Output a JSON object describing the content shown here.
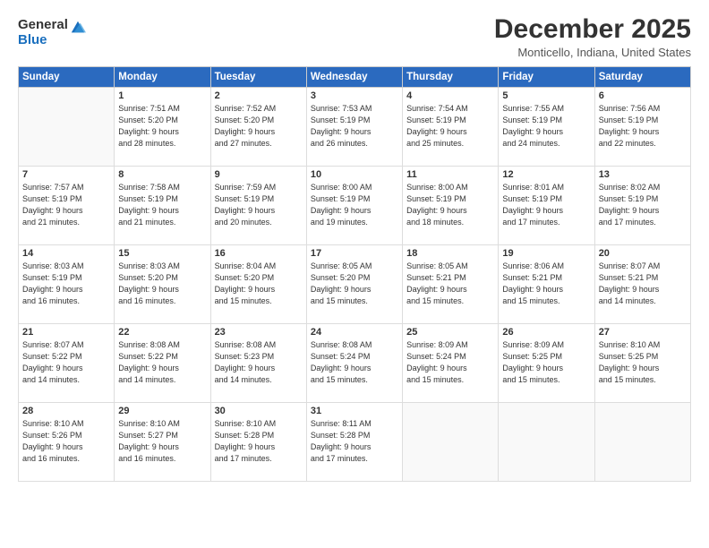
{
  "logo": {
    "general": "General",
    "blue": "Blue"
  },
  "title": "December 2025",
  "location": "Monticello, Indiana, United States",
  "days_of_week": [
    "Sunday",
    "Monday",
    "Tuesday",
    "Wednesday",
    "Thursday",
    "Friday",
    "Saturday"
  ],
  "weeks": [
    [
      {
        "day": "",
        "info": ""
      },
      {
        "day": "1",
        "info": "Sunrise: 7:51 AM\nSunset: 5:20 PM\nDaylight: 9 hours\nand 28 minutes."
      },
      {
        "day": "2",
        "info": "Sunrise: 7:52 AM\nSunset: 5:20 PM\nDaylight: 9 hours\nand 27 minutes."
      },
      {
        "day": "3",
        "info": "Sunrise: 7:53 AM\nSunset: 5:19 PM\nDaylight: 9 hours\nand 26 minutes."
      },
      {
        "day": "4",
        "info": "Sunrise: 7:54 AM\nSunset: 5:19 PM\nDaylight: 9 hours\nand 25 minutes."
      },
      {
        "day": "5",
        "info": "Sunrise: 7:55 AM\nSunset: 5:19 PM\nDaylight: 9 hours\nand 24 minutes."
      },
      {
        "day": "6",
        "info": "Sunrise: 7:56 AM\nSunset: 5:19 PM\nDaylight: 9 hours\nand 22 minutes."
      }
    ],
    [
      {
        "day": "7",
        "info": "Sunrise: 7:57 AM\nSunset: 5:19 PM\nDaylight: 9 hours\nand 21 minutes."
      },
      {
        "day": "8",
        "info": "Sunrise: 7:58 AM\nSunset: 5:19 PM\nDaylight: 9 hours\nand 21 minutes."
      },
      {
        "day": "9",
        "info": "Sunrise: 7:59 AM\nSunset: 5:19 PM\nDaylight: 9 hours\nand 20 minutes."
      },
      {
        "day": "10",
        "info": "Sunrise: 8:00 AM\nSunset: 5:19 PM\nDaylight: 9 hours\nand 19 minutes."
      },
      {
        "day": "11",
        "info": "Sunrise: 8:00 AM\nSunset: 5:19 PM\nDaylight: 9 hours\nand 18 minutes."
      },
      {
        "day": "12",
        "info": "Sunrise: 8:01 AM\nSunset: 5:19 PM\nDaylight: 9 hours\nand 17 minutes."
      },
      {
        "day": "13",
        "info": "Sunrise: 8:02 AM\nSunset: 5:19 PM\nDaylight: 9 hours\nand 17 minutes."
      }
    ],
    [
      {
        "day": "14",
        "info": "Sunrise: 8:03 AM\nSunset: 5:19 PM\nDaylight: 9 hours\nand 16 minutes."
      },
      {
        "day": "15",
        "info": "Sunrise: 8:03 AM\nSunset: 5:20 PM\nDaylight: 9 hours\nand 16 minutes."
      },
      {
        "day": "16",
        "info": "Sunrise: 8:04 AM\nSunset: 5:20 PM\nDaylight: 9 hours\nand 15 minutes."
      },
      {
        "day": "17",
        "info": "Sunrise: 8:05 AM\nSunset: 5:20 PM\nDaylight: 9 hours\nand 15 minutes."
      },
      {
        "day": "18",
        "info": "Sunrise: 8:05 AM\nSunset: 5:21 PM\nDaylight: 9 hours\nand 15 minutes."
      },
      {
        "day": "19",
        "info": "Sunrise: 8:06 AM\nSunset: 5:21 PM\nDaylight: 9 hours\nand 15 minutes."
      },
      {
        "day": "20",
        "info": "Sunrise: 8:07 AM\nSunset: 5:21 PM\nDaylight: 9 hours\nand 14 minutes."
      }
    ],
    [
      {
        "day": "21",
        "info": "Sunrise: 8:07 AM\nSunset: 5:22 PM\nDaylight: 9 hours\nand 14 minutes."
      },
      {
        "day": "22",
        "info": "Sunrise: 8:08 AM\nSunset: 5:22 PM\nDaylight: 9 hours\nand 14 minutes."
      },
      {
        "day": "23",
        "info": "Sunrise: 8:08 AM\nSunset: 5:23 PM\nDaylight: 9 hours\nand 14 minutes."
      },
      {
        "day": "24",
        "info": "Sunrise: 8:08 AM\nSunset: 5:24 PM\nDaylight: 9 hours\nand 15 minutes."
      },
      {
        "day": "25",
        "info": "Sunrise: 8:09 AM\nSunset: 5:24 PM\nDaylight: 9 hours\nand 15 minutes."
      },
      {
        "day": "26",
        "info": "Sunrise: 8:09 AM\nSunset: 5:25 PM\nDaylight: 9 hours\nand 15 minutes."
      },
      {
        "day": "27",
        "info": "Sunrise: 8:10 AM\nSunset: 5:25 PM\nDaylight: 9 hours\nand 15 minutes."
      }
    ],
    [
      {
        "day": "28",
        "info": "Sunrise: 8:10 AM\nSunset: 5:26 PM\nDaylight: 9 hours\nand 16 minutes."
      },
      {
        "day": "29",
        "info": "Sunrise: 8:10 AM\nSunset: 5:27 PM\nDaylight: 9 hours\nand 16 minutes."
      },
      {
        "day": "30",
        "info": "Sunrise: 8:10 AM\nSunset: 5:28 PM\nDaylight: 9 hours\nand 17 minutes."
      },
      {
        "day": "31",
        "info": "Sunrise: 8:11 AM\nSunset: 5:28 PM\nDaylight: 9 hours\nand 17 minutes."
      },
      {
        "day": "",
        "info": ""
      },
      {
        "day": "",
        "info": ""
      },
      {
        "day": "",
        "info": ""
      }
    ]
  ]
}
